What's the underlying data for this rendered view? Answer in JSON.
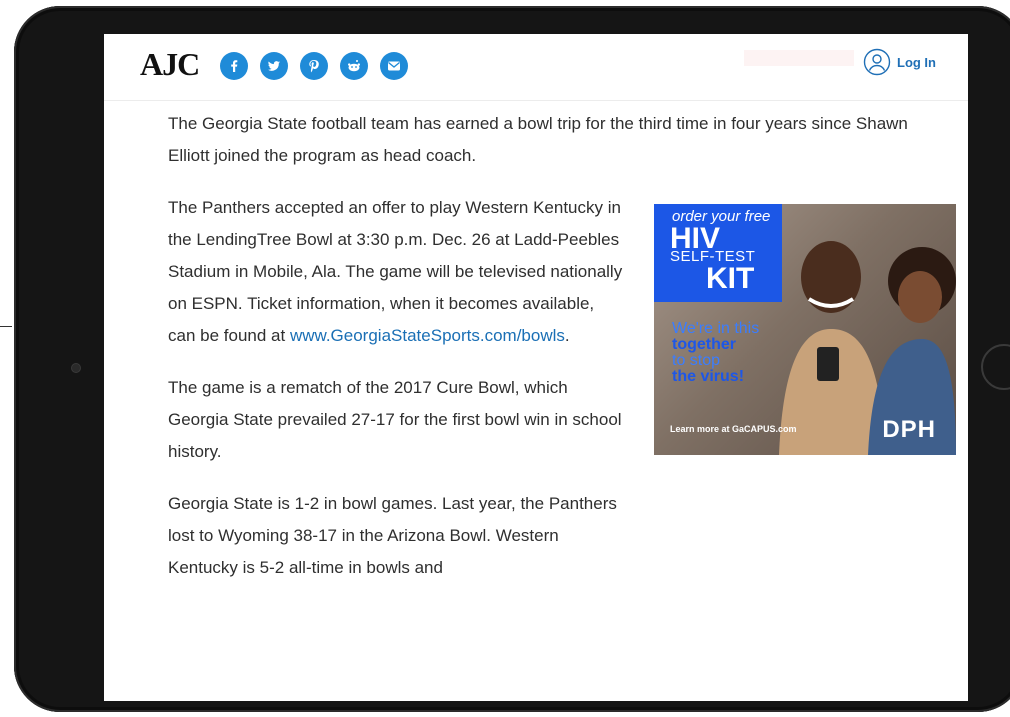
{
  "header": {
    "logo": "AJC",
    "social_icons": [
      "facebook-icon",
      "twitter-icon",
      "pinterest-icon",
      "reddit-icon",
      "email-icon"
    ],
    "login_label": "Log In"
  },
  "article": {
    "p1": "The Georgia State football team has earned a bowl trip for the third time in four years since Shawn Elliott joined the program as head coach.",
    "p2_text": "The Panthers accepted an offer to play Western Kentucky in the LendingTree Bowl at 3:30 p.m. Dec. 26 at Ladd-Peebles Stadium in Mobile, Ala. The game will be televised nationally on ESPN. Ticket information, when it becomes available, can be found at ",
    "p2_link": "www.GeorgiaStateSports.com/bowls",
    "p2_end": ".",
    "p3": "The game is a rematch of the 2017 Cure Bowl, which Georgia State prevailed 27-17 for the first bowl win in school history.",
    "p4": "Georgia State is 1-2 in bowl games. Last year, the Panthers lost to Wyoming 38-17 in the Arizona Bowl. Western Kentucky is 5-2 all-time in bowls and"
  },
  "ad": {
    "line1": "order your free",
    "line2": "HIV",
    "line3": "SELF-TEST",
    "line4": "KIT",
    "tag1": "We're in this",
    "tag2": "together",
    "tag3": "to stop",
    "tag4": "the virus!",
    "learn": "Learn more at GaCAPUS.com",
    "brand": "DPH"
  },
  "colors": {
    "accent": "#1f8bd8",
    "link": "#1a6fb5",
    "ad_blue": "#1c57e6"
  }
}
